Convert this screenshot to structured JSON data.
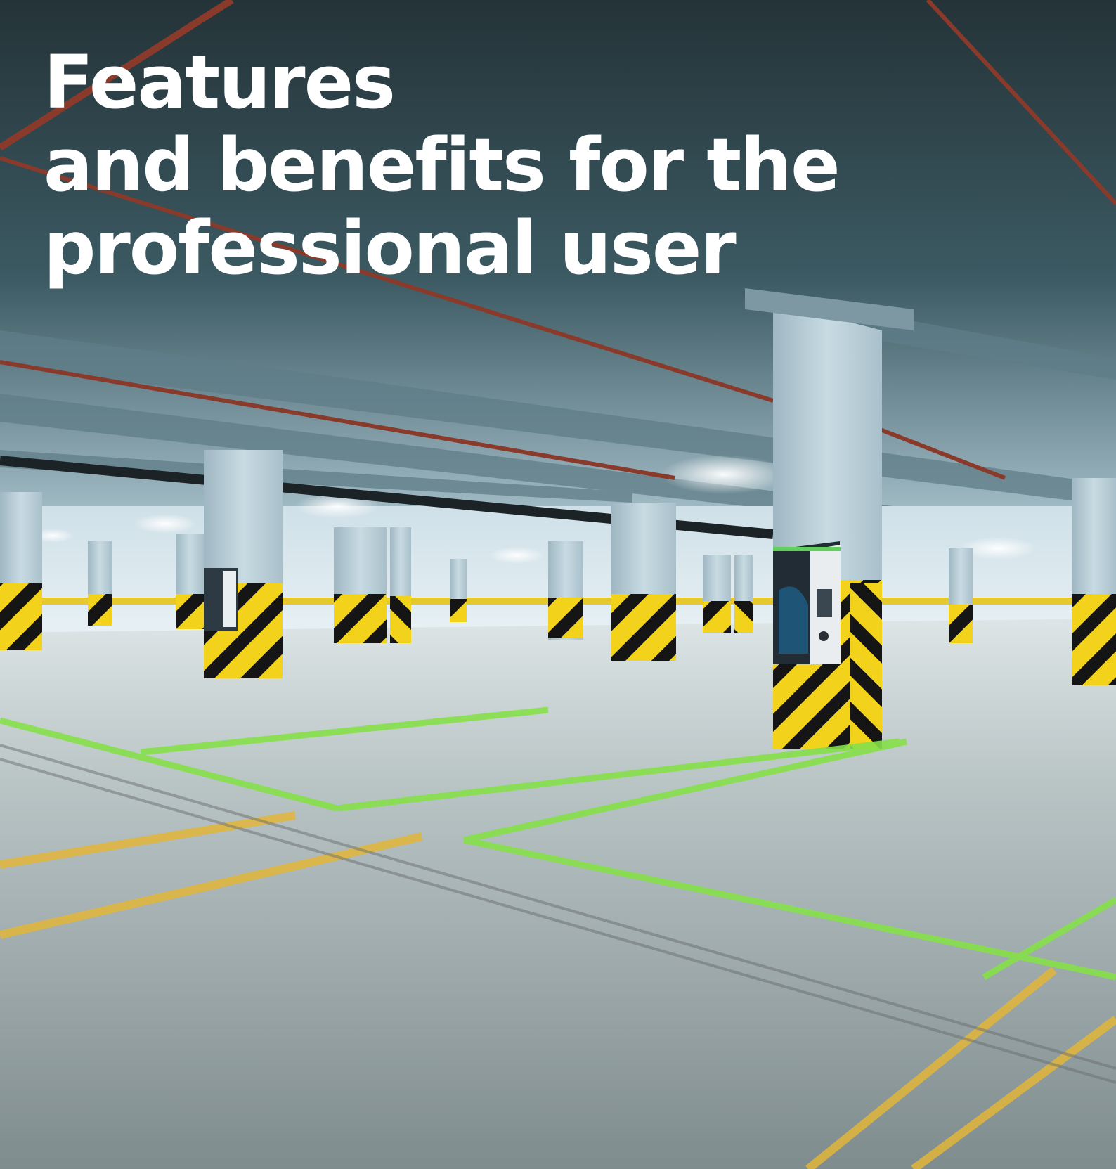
{
  "headline": {
    "line1": "Features",
    "line2": "and benefits for the",
    "line3": "professional user"
  },
  "colors": {
    "headline_text": "#ffffff",
    "ceiling": "#2f4248",
    "floor": "#9aa7a8",
    "pillar_blue": "#b9cdd6",
    "hazard_yellow": "#f2d21a",
    "hazard_black": "#111111",
    "parking_line_green": "#7fdc3c",
    "parking_line_yellow": "#e0b43a",
    "pipe_red": "#8a3a2a"
  },
  "scene_objects": [
    "underground-parking-garage",
    "ev-charging-station",
    "concrete-pillars",
    "hazard-stripes",
    "parking-lines",
    "ceiling-lights"
  ]
}
